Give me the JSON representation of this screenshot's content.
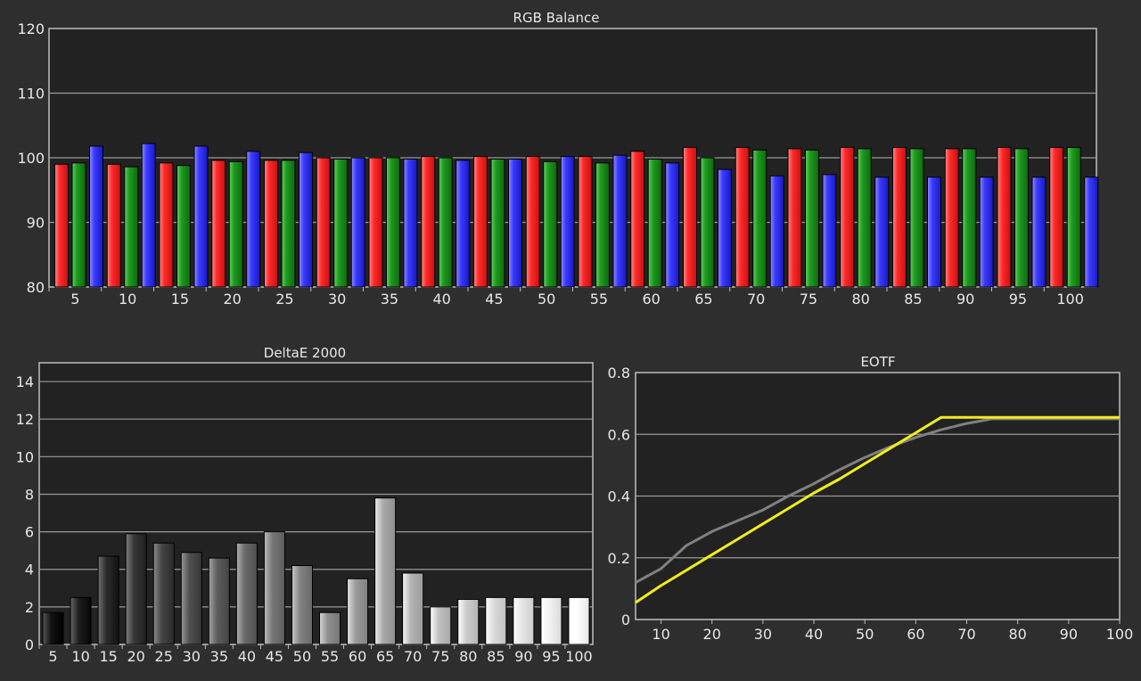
{
  "colors": {
    "page_bg": "#2e2e2e",
    "plot_bg": "#222222",
    "grid": "#9a9a9a",
    "frame": "#bdbdbd",
    "text": "#e8e8e8",
    "red": "#ff2a2a",
    "green": "#1f8f1f",
    "blue": "#3a3aff",
    "eotf_measured": "#808080",
    "eotf_target": "#f2ee1a"
  },
  "chart_data": [
    {
      "id": "rgb",
      "type": "bar",
      "title": "RGB Balance",
      "xlabel": "",
      "ylabel": "",
      "ylim": [
        80,
        120
      ],
      "yticks": [
        80,
        90,
        100,
        110,
        120
      ],
      "grid": true,
      "categories": [
        "5",
        "10",
        "15",
        "20",
        "25",
        "30",
        "35",
        "40",
        "45",
        "50",
        "55",
        "60",
        "65",
        "70",
        "75",
        "80",
        "85",
        "90",
        "95",
        "100"
      ],
      "series": [
        {
          "color_key": "red",
          "values": [
            99.0,
            99.0,
            99.2,
            99.6,
            99.6,
            100.0,
            100.0,
            100.2,
            100.2,
            100.2,
            100.2,
            101.0,
            101.6,
            101.6,
            101.4,
            101.6,
            101.6,
            101.4,
            101.6,
            101.6
          ]
        },
        {
          "color_key": "green",
          "values": [
            99.2,
            98.6,
            98.8,
            99.4,
            99.6,
            99.8,
            100.0,
            100.0,
            99.8,
            99.4,
            99.2,
            99.8,
            100.0,
            101.2,
            101.2,
            101.4,
            101.4,
            101.4,
            101.4,
            101.6
          ]
        },
        {
          "color_key": "blue",
          "values": [
            101.8,
            102.2,
            101.8,
            101.0,
            100.8,
            100.0,
            99.8,
            99.6,
            99.8,
            100.2,
            100.4,
            99.2,
            98.2,
            97.2,
            97.4,
            97.0,
            97.0,
            97.0,
            97.0,
            97.0
          ]
        }
      ]
    },
    {
      "id": "deltae",
      "type": "bar",
      "title": "DeltaE 2000",
      "xlabel": "",
      "ylabel": "",
      "ylim": [
        0,
        15
      ],
      "yticks": [
        0,
        2,
        4,
        6,
        8,
        10,
        12,
        14
      ],
      "grid": true,
      "categories": [
        "5",
        "10",
        "15",
        "20",
        "25",
        "30",
        "35",
        "40",
        "45",
        "50",
        "55",
        "60",
        "65",
        "70",
        "75",
        "80",
        "85",
        "90",
        "95",
        "100"
      ],
      "values": [
        1.7,
        2.5,
        4.7,
        5.9,
        5.4,
        4.9,
        4.6,
        5.4,
        6.0,
        4.2,
        1.7,
        3.5,
        7.8,
        3.8,
        2.0,
        2.4,
        2.5,
        2.5,
        2.5,
        2.5
      ]
    },
    {
      "id": "eotf",
      "type": "line",
      "title": "EOTF",
      "xlabel": "",
      "ylabel": "",
      "xlim": [
        5,
        100
      ],
      "ylim": [
        0,
        0.8
      ],
      "xticks": [
        10,
        20,
        30,
        40,
        50,
        60,
        70,
        80,
        90,
        100
      ],
      "yticks": [
        0,
        0.2,
        0.4,
        0.6,
        0.8
      ],
      "yticklabels": [
        "0",
        "0.2",
        "0.4",
        "0.6",
        "0.8"
      ],
      "grid": true,
      "series": [
        {
          "color_key": "eotf_measured",
          "x": [
            5,
            10,
            15,
            20,
            25,
            30,
            35,
            40,
            45,
            50,
            55,
            60,
            65,
            70,
            75,
            80,
            85,
            90,
            95,
            100
          ],
          "y": [
            0.12,
            0.165,
            0.24,
            0.285,
            0.32,
            0.355,
            0.4,
            0.44,
            0.485,
            0.525,
            0.56,
            0.59,
            0.615,
            0.635,
            0.65,
            0.65,
            0.65,
            0.65,
            0.65,
            0.65
          ]
        },
        {
          "color_key": "eotf_target",
          "x": [
            5,
            10,
            15,
            20,
            25,
            30,
            35,
            40,
            45,
            50,
            55,
            60,
            65,
            70,
            75,
            80,
            85,
            90,
            95,
            100
          ],
          "y": [
            0.055,
            0.11,
            0.16,
            0.21,
            0.26,
            0.31,
            0.36,
            0.41,
            0.455,
            0.505,
            0.555,
            0.605,
            0.655,
            0.655,
            0.655,
            0.655,
            0.655,
            0.655,
            0.655,
            0.655
          ]
        }
      ]
    }
  ]
}
